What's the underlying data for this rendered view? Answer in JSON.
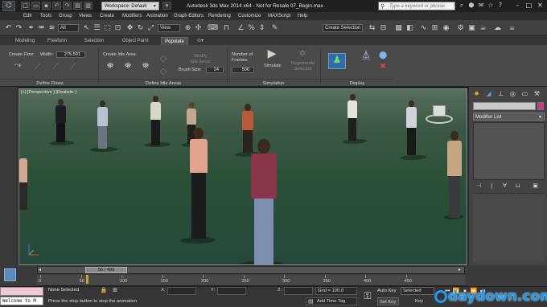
{
  "title_bar": {
    "logo_glyph": "⌬",
    "workspace_label": "Workspace: Default",
    "window_title": "Autodesk 3ds Max  2014 x64  -  Not for Resale    07_Begin.max",
    "search_placeholder": "Type a keyword or phrase"
  },
  "menu": [
    "Edit",
    "Tools",
    "Group",
    "Views",
    "Create",
    "Modifiers",
    "Animation",
    "Graph Editors",
    "Rendering",
    "Customize",
    "MAXScript",
    "Help"
  ],
  "toolbar": {
    "filter_value": "All",
    "refcoord_value": "View",
    "named_selection_placeholder": "Create Selection Se"
  },
  "ribbon_tabs": [
    {
      "label": "Modeling",
      "active": false
    },
    {
      "label": "Freeform",
      "active": false
    },
    {
      "label": "Selection",
      "active": false
    },
    {
      "label": "Object Paint",
      "active": false
    },
    {
      "label": "Populate",
      "active": true
    }
  ],
  "ribbon": {
    "create_flow_label": "Create Flow:",
    "width_label": "Width:",
    "width_value": "275.591",
    "create_idle_label": "Create Idle Area:",
    "modify_idle_label": "Modify\nIdle Areas",
    "brush_size_label": "Brush Size:",
    "brush_size_value": "24",
    "num_frames_label": "Number of\nFrames:",
    "num_frames_value": "500",
    "simulate_label": "Simulate",
    "regenerate_label": "Regenerate\nSelected",
    "groups": [
      "Define Flows",
      "Define Idle Areas",
      "Simulation",
      "Display"
    ]
  },
  "viewport": {
    "label": "[+] [Perspective ] [Realistic ]"
  },
  "command_panel": {
    "modifier_list_label": "Modifier List"
  },
  "timeline": {
    "current_frame": "56 / 499",
    "ticks": [
      "0",
      "50",
      "100",
      "150",
      "200",
      "250",
      "300",
      "350",
      "400",
      "450"
    ],
    "progress_fraction": 0.112
  },
  "status": {
    "selection": "None Selected",
    "prompt": "Press the stop button to stop the animation",
    "maxscript_text": "Welcome to M",
    "x_label": "X:",
    "y_label": "Y:",
    "z_label": "Z:",
    "grid": "Grid = 100.0",
    "add_time_tag": "Add Time Tag",
    "auto_key": "Auto Key",
    "set_key": "Set Key",
    "selected_dd": "Selected",
    "key_filters": "Key Filters..."
  },
  "watermark": {
    "text": "daydown.com"
  },
  "colors": {
    "accent_pink": "#d6328a",
    "viewport_ground": "#2c5038",
    "watermark_blue": "#1e9bf0"
  }
}
